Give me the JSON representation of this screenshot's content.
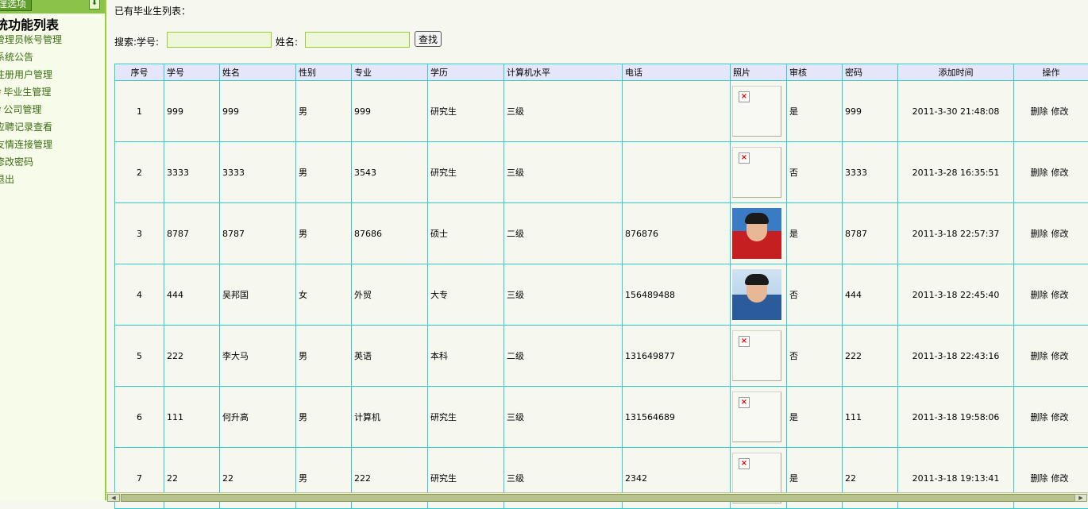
{
  "sidebar": {
    "header_label": "理选项",
    "toggle_icon": "down-arrow-icon",
    "title": "统功能列表",
    "items": [
      {
        "label": "管理员帐号管理",
        "bullet": false
      },
      {
        "label": "系统公告",
        "bullet": false
      },
      {
        "label": "注册用户管理",
        "bullet": false
      },
      {
        "label": "毕业生管理",
        "bullet": true
      },
      {
        "label": "公司管理",
        "bullet": true
      },
      {
        "label": "应聘记录查看",
        "bullet": false
      },
      {
        "label": "友情连接管理",
        "bullet": false
      },
      {
        "label": "修改密码",
        "bullet": false
      },
      {
        "label": "退出",
        "bullet": false
      }
    ]
  },
  "main": {
    "title": "已有毕业生列表：",
    "search": {
      "label": "搜索:学号:",
      "id_value": "",
      "name_label": "姓名:",
      "name_value": "",
      "button": "查找"
    }
  },
  "table": {
    "columns": [
      "序号",
      "学号",
      "姓名",
      "性别",
      "专业",
      "学历",
      "计算机水平",
      "电话",
      "照片",
      "审核",
      "密码",
      "添加时间",
      "操作"
    ],
    "delete_label": "删除",
    "edit_label": "修改",
    "rows": [
      {
        "no": "1",
        "sid": "999",
        "name": "999",
        "gender": "男",
        "major": "999",
        "degree": "研究生",
        "computer": "三级",
        "phone": "",
        "photo": "broken",
        "audit": "是",
        "password": "999",
        "added": "2011-3-30 21:48:08"
      },
      {
        "no": "2",
        "sid": "3333",
        "name": "3333",
        "gender": "男",
        "major": "3543",
        "degree": "研究生",
        "computer": "三级",
        "phone": "",
        "photo": "broken",
        "audit": "否",
        "password": "3333",
        "added": "2011-3-28 16:35:51"
      },
      {
        "no": "3",
        "sid": "8787",
        "name": "8787",
        "gender": "男",
        "major": "87686",
        "degree": "硕士",
        "computer": "二级",
        "phone": "876876",
        "photo": "red",
        "audit": "是",
        "password": "8787",
        "added": "2011-3-18 22:57:37"
      },
      {
        "no": "4",
        "sid": "444",
        "name": "吴邦国",
        "gender": "女",
        "major": "外贸",
        "degree": "大专",
        "computer": "三级",
        "phone": "156489488",
        "photo": "blue",
        "audit": "否",
        "password": "444",
        "added": "2011-3-18 22:45:40"
      },
      {
        "no": "5",
        "sid": "222",
        "name": "李大马",
        "gender": "男",
        "major": "英语",
        "degree": "本科",
        "computer": "二级",
        "phone": "131649877",
        "photo": "broken",
        "audit": "否",
        "password": "222",
        "added": "2011-3-18 22:43:16"
      },
      {
        "no": "6",
        "sid": "111",
        "name": "何升高",
        "gender": "男",
        "major": "计算机",
        "degree": "研究生",
        "computer": "三级",
        "phone": "131564689",
        "photo": "broken",
        "audit": "是",
        "password": "111",
        "added": "2011-3-18 19:58:06"
      },
      {
        "no": "7",
        "sid": "22",
        "name": "22",
        "gender": "男",
        "major": "222",
        "degree": "研究生",
        "computer": "三级",
        "phone": "2342",
        "photo": "broken",
        "audit": "是",
        "password": "22",
        "added": "2011-3-18 19:13:41"
      }
    ]
  },
  "scrollbar": {
    "left_icon": "scroll-left-icon",
    "right_icon": "scroll-right-icon"
  }
}
